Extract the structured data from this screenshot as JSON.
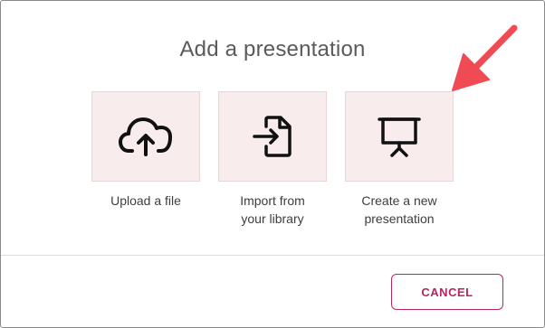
{
  "dialog": {
    "title": "Add a presentation",
    "options": [
      {
        "icon": "cloud-upload-icon",
        "label": "Upload a file"
      },
      {
        "icon": "file-import-icon",
        "label": "Import from\nyour library"
      },
      {
        "icon": "presentation-screen-icon",
        "label": "Create a new\npresentation"
      }
    ],
    "cancel_label": "CANCEL"
  },
  "colors": {
    "tile_background": "#f8eced",
    "accent": "#b8265e",
    "annotation_arrow": "#f04b54"
  }
}
